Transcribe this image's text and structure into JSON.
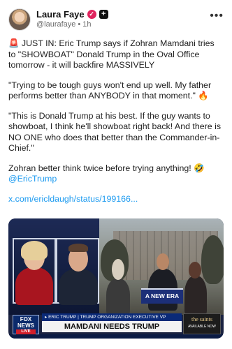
{
  "post": {
    "display_name": "Laura Faye",
    "verified_glyph": "✓",
    "plus_glyph": "+",
    "handle": "@laurafaye",
    "separator": "•",
    "time": "1h",
    "more_glyph": "•••"
  },
  "body": {
    "p1": "🚨 JUST IN: Eric Trump says if Zohran Mamdani tries to \"SHOWBOAT\" Donald Trump in the Oval Office tomorrow - it will backfire MASSIVELY",
    "p2": "\"Trying to be tough guys won't end up well. My father performs better than ANYBODY in that moment.\" 🔥",
    "p3": "\"This is Donald Trump at his best. If the guy wants to showboat, I think he'll showboat right back! And there is NO ONE who does that better than the Commander-in-Chief.\"",
    "p4_text": "Zohran better think twice before trying anything! 🤣",
    "p4_mention": "@EricTrump",
    "link": "x.com/ericldaugh/status/199166..."
  },
  "media": {
    "lectern_text": "A NEW ERA",
    "chyron_top": "▸ ERIC TRUMP | TRUMP ORGANIZATION EXECUTIVE VP",
    "chyron_main": "MAMDANI NEEDS TRUMP",
    "logo_line1": "FOX",
    "logo_line2": "NEWS",
    "logo_live": "LIVE",
    "promo_title": "the saints",
    "promo_sub": "AVAILABLE NOW"
  }
}
